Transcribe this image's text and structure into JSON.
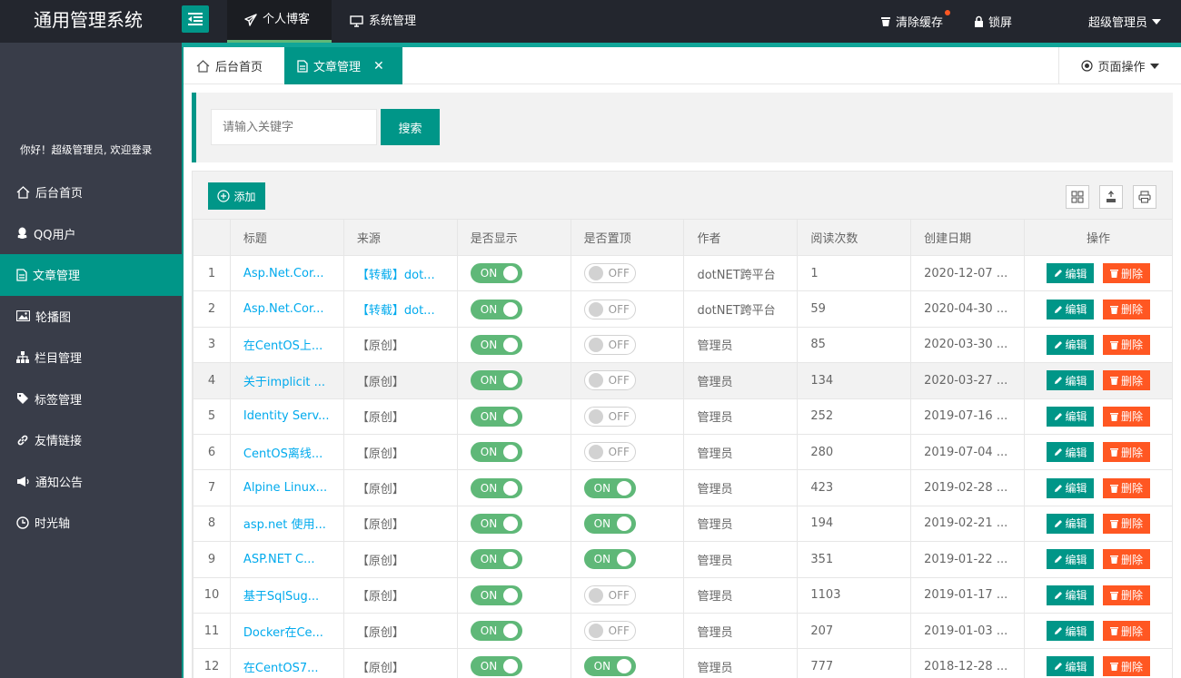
{
  "app": {
    "title": "通用管理系统",
    "nav": [
      {
        "label": "个人博客",
        "icon": "paper-plane-icon",
        "active": true
      },
      {
        "label": "系统管理",
        "icon": "monitor-icon",
        "active": false
      }
    ],
    "right": {
      "clear_cache": "清除缓存",
      "lock": "锁屏",
      "user": "超级管理员"
    }
  },
  "sidebar": {
    "welcome": "你好！超级管理员, 欢迎登录",
    "items": [
      {
        "label": "后台首页",
        "icon": "home-icon"
      },
      {
        "label": "QQ用户",
        "icon": "qq-icon"
      },
      {
        "label": "文章管理",
        "icon": "document-icon",
        "active": true
      },
      {
        "label": "轮播图",
        "icon": "image-icon"
      },
      {
        "label": "栏目管理",
        "icon": "sitemap-icon"
      },
      {
        "label": "标签管理",
        "icon": "tag-icon"
      },
      {
        "label": "友情链接",
        "icon": "link-icon"
      },
      {
        "label": "通知公告",
        "icon": "megaphone-icon"
      },
      {
        "label": "时光轴",
        "icon": "clock-icon"
      }
    ]
  },
  "tabs": {
    "home": "后台首页",
    "article": "文章管理",
    "page_ops": "页面操作"
  },
  "search": {
    "placeholder": "请输入关键字",
    "button": "搜索"
  },
  "toolbar": {
    "add": "添加"
  },
  "table": {
    "headers": [
      "",
      "标题",
      "来源",
      "是否显示",
      "是否置顶",
      "作者",
      "阅读次数",
      "创建日期",
      "操作"
    ],
    "on_label": "ON",
    "off_label": "OFF",
    "edit_label": "编辑",
    "delete_label": "删除",
    "rows": [
      {
        "no": "1",
        "title": "Asp.Net.Cor...",
        "source": "【转载】dot...",
        "source_link": true,
        "show": true,
        "top": false,
        "author": "dotNET跨平台",
        "reads": "1",
        "date": "2020-12-07 ..."
      },
      {
        "no": "2",
        "title": "Asp.Net.Cor...",
        "source": "【转载】dot...",
        "source_link": true,
        "show": true,
        "top": false,
        "author": "dotNET跨平台",
        "reads": "59",
        "date": "2020-04-30 ..."
      },
      {
        "no": "3",
        "title": "在CentOS上...",
        "source": "【原创】",
        "show": true,
        "top": false,
        "author": "管理员",
        "reads": "85",
        "date": "2020-03-30 ..."
      },
      {
        "no": "4",
        "title": "关于implicit ...",
        "source": "【原创】",
        "show": true,
        "top": false,
        "author": "管理员",
        "reads": "134",
        "date": "2020-03-27 ..."
      },
      {
        "no": "5",
        "title": "Identity Serv...",
        "source": "【原创】",
        "show": true,
        "top": false,
        "author": "管理员",
        "reads": "252",
        "date": "2019-07-16 ..."
      },
      {
        "no": "6",
        "title": "CentOS离线...",
        "source": "【原创】",
        "show": true,
        "top": false,
        "author": "管理员",
        "reads": "280",
        "date": "2019-07-04 ..."
      },
      {
        "no": "7",
        "title": "Alpine Linux...",
        "source": "【原创】",
        "show": true,
        "top": true,
        "author": "管理员",
        "reads": "423",
        "date": "2019-02-28 ..."
      },
      {
        "no": "8",
        "title": "asp.net 使用...",
        "source": "【原创】",
        "show": true,
        "top": true,
        "author": "管理员",
        "reads": "194",
        "date": "2019-02-21 ..."
      },
      {
        "no": "9",
        "title": "ASP.NET C...",
        "source": "【原创】",
        "show": true,
        "top": true,
        "author": "管理员",
        "reads": "351",
        "date": "2019-01-22 ..."
      },
      {
        "no": "10",
        "title": "基于SqlSug...",
        "source": "【原创】",
        "show": true,
        "top": false,
        "author": "管理员",
        "reads": "1103",
        "date": "2019-01-17 ..."
      },
      {
        "no": "11",
        "title": "Docker在Ce...",
        "source": "【原创】",
        "show": true,
        "top": false,
        "author": "管理员",
        "reads": "207",
        "date": "2019-01-03 ..."
      },
      {
        "no": "12",
        "title": "在CentOS7...",
        "source": "【原创】",
        "show": true,
        "top": true,
        "author": "管理员",
        "reads": "777",
        "date": "2018-12-28 ..."
      }
    ]
  },
  "colors": {
    "accent": "#009688",
    "header_bg": "#23262e",
    "sidebar_bg": "#393d49",
    "switch_on": "#5fb878",
    "danger": "#ff5722",
    "link": "#01aaed"
  }
}
